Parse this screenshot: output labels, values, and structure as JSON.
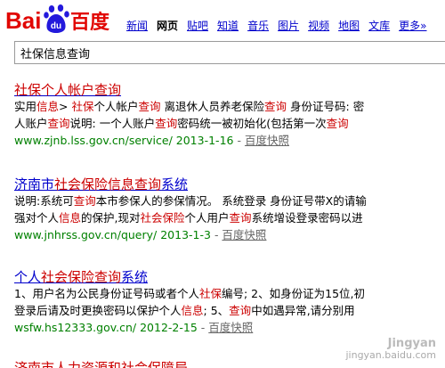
{
  "logo": {
    "text_left": "Bai",
    "text_paw": "du",
    "text_right": "百度"
  },
  "nav": {
    "items": [
      "新闻",
      "网页",
      "贴吧",
      "知道",
      "音乐",
      "图片",
      "视频",
      "地图",
      "文库",
      "更多»"
    ],
    "current": "网页"
  },
  "search": {
    "query": "社保信息查询"
  },
  "results": [
    {
      "title": [
        "社保个人帐户查询"
      ],
      "title_em": [
        true
      ],
      "desc1": [
        "实用",
        "信息",
        "> ",
        "社保",
        "个人帐户",
        "查询",
        " 离退休人员养老保险",
        "查询",
        " 身份证号码: 密"
      ],
      "desc1_em": [
        false,
        true,
        false,
        true,
        false,
        true,
        false,
        true,
        false
      ],
      "desc2": [
        "人账户",
        "查询",
        "说明: 一个人账户",
        "查询",
        "密码统一被初始化(包括第一次",
        "查询"
      ],
      "desc2_em": [
        false,
        true,
        false,
        true,
        false,
        true
      ],
      "url": "www.zjnb.lss.gov.cn/service/ 2013-1-16",
      "cache": "百度快照"
    },
    {
      "title": [
        "济南市",
        "社会保险信息查询",
        "系统"
      ],
      "title_em": [
        false,
        true,
        false
      ],
      "desc1": [
        "说明:系统可",
        "查询",
        "本市参保人的参保情况。 系统登录 身份证号带X的请输"
      ],
      "desc1_em": [
        false,
        true,
        false
      ],
      "desc2": [
        "强对个人",
        "信息",
        "的保护,现对",
        "社会保险",
        "个人用户",
        "查询",
        "系统增设登录密码以进"
      ],
      "desc2_em": [
        false,
        true,
        false,
        true,
        false,
        true,
        false
      ],
      "url": "www.jnhrss.gov.cn/query/ 2013-1-3",
      "cache": "百度快照"
    },
    {
      "title": [
        "个人",
        "社会保险查询",
        "系统"
      ],
      "title_em": [
        false,
        true,
        false
      ],
      "desc1": [
        "1、用户名为公民身份证号码或者个人",
        "社保",
        "编号; 2、如身份证为15位,初"
      ],
      "desc1_em": [
        false,
        true,
        false
      ],
      "desc2": [
        "登录后请及时更换密码以保护个人",
        "信息",
        "; 5、",
        "查询",
        "中如遇异常,请分别用"
      ],
      "desc2_em": [
        false,
        true,
        false,
        true,
        false
      ],
      "url": "wsfw.hs12333.gov.cn/ 2012-2-15",
      "cache": "百度快照"
    },
    {
      "title": [
        "济南市人力资源和社会保障局"
      ],
      "title_em": [
        true
      ]
    }
  ],
  "watermark": {
    "brand": "Jingyan",
    "site": "jingyan.baidu.com"
  },
  "colors": {
    "link": "#0000cc",
    "highlight": "#cc0000",
    "url": "#008000",
    "cache": "#666666",
    "logo_red": "#e10602",
    "logo_blue": "#2319dc"
  }
}
